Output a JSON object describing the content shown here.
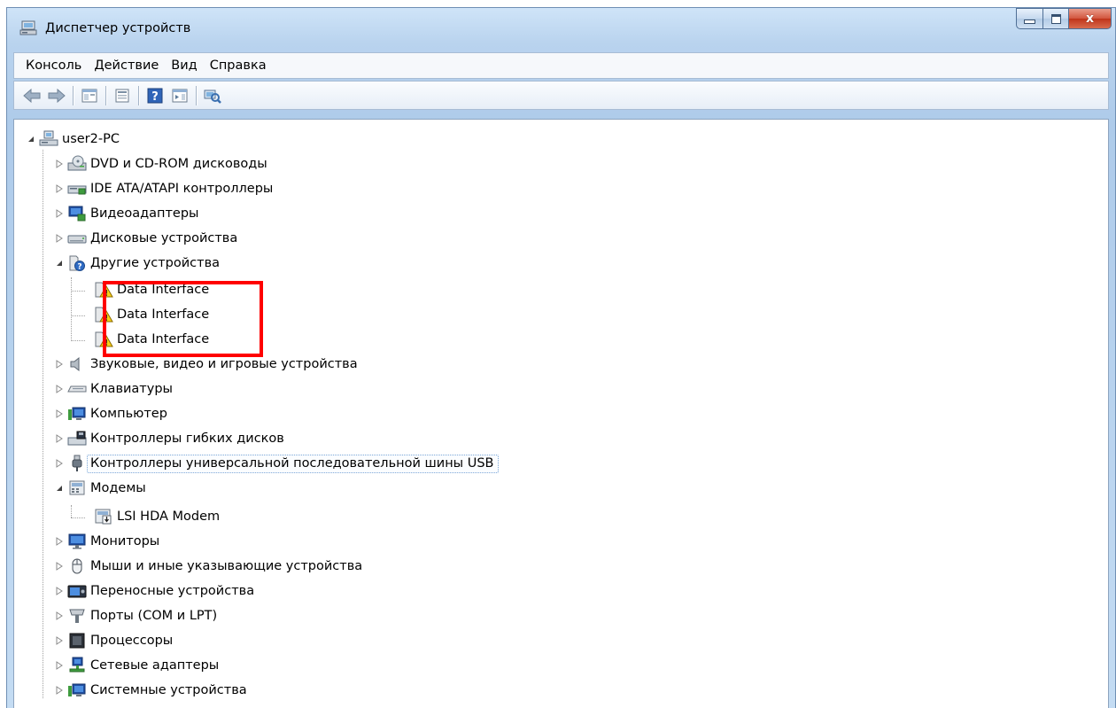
{
  "window": {
    "title": "Диспетчер устройств",
    "close_symbol": "x"
  },
  "menu": [
    {
      "label": "Консоль"
    },
    {
      "label": "Действие"
    },
    {
      "label": "Вид"
    },
    {
      "label": "Справка"
    }
  ],
  "toolbar": [
    {
      "icon": "back-arrow-icon"
    },
    {
      "icon": "forward-arrow-icon"
    },
    {
      "icon": "show-hide-console-tree-icon"
    },
    {
      "icon": "properties-icon"
    },
    {
      "icon": "help-icon"
    },
    {
      "icon": "show-action-pane-icon"
    },
    {
      "icon": "scan-hardware-changes-icon"
    }
  ],
  "tree": {
    "root": {
      "label": "user2-PC",
      "icon": "computer-network-icon",
      "expanded": true
    },
    "categories": [
      {
        "label": "DVD и CD-ROM дисководы",
        "icon": "dvd-drive-icon",
        "expanded": false
      },
      {
        "label": "IDE ATA/ATAPI контроллеры",
        "icon": "ide-controller-icon",
        "expanded": false
      },
      {
        "label": "Видеоадаптеры",
        "icon": "display-adapter-icon",
        "expanded": false
      },
      {
        "label": "Дисковые устройства",
        "icon": "disk-drive-icon",
        "expanded": false
      },
      {
        "label": "Другие устройства",
        "icon": "unknown-device-icon",
        "expanded": true,
        "children": [
          {
            "label": "Data Interface",
            "icon": "warning-device-icon"
          },
          {
            "label": "Data Interface",
            "icon": "warning-device-icon"
          },
          {
            "label": "Data Interface",
            "icon": "warning-device-icon"
          }
        ]
      },
      {
        "label": "Звуковые, видео и игровые устройства",
        "icon": "speaker-icon",
        "expanded": false
      },
      {
        "label": "Клавиатуры",
        "icon": "keyboard-icon",
        "expanded": false
      },
      {
        "label": "Компьютер",
        "icon": "computer-icon",
        "expanded": false
      },
      {
        "label": "Контроллеры гибких дисков",
        "icon": "floppy-controller-icon",
        "expanded": false
      },
      {
        "label": "Контроллеры универсальной последовательной шины USB",
        "icon": "usb-icon",
        "expanded": false,
        "selected": true
      },
      {
        "label": "Модемы",
        "icon": "modem-icon",
        "expanded": true,
        "children": [
          {
            "label": "LSI HDA Modem",
            "icon": "modem-device-icon"
          }
        ]
      },
      {
        "label": "Мониторы",
        "icon": "monitor-icon",
        "expanded": false
      },
      {
        "label": "Мыши и иные указывающие устройства",
        "icon": "mouse-icon",
        "expanded": false
      },
      {
        "label": "Переносные устройства",
        "icon": "portable-device-icon",
        "expanded": false
      },
      {
        "label": "Порты (COM и LPT)",
        "icon": "port-icon",
        "expanded": false
      },
      {
        "label": "Процессоры",
        "icon": "processor-icon",
        "expanded": false
      },
      {
        "label": "Сетевые адаптеры",
        "icon": "network-adapter-icon",
        "expanded": false
      },
      {
        "label": "Системные устройства",
        "icon": "system-device-icon",
        "expanded": false
      }
    ]
  },
  "highlight_color": "#ff0000"
}
